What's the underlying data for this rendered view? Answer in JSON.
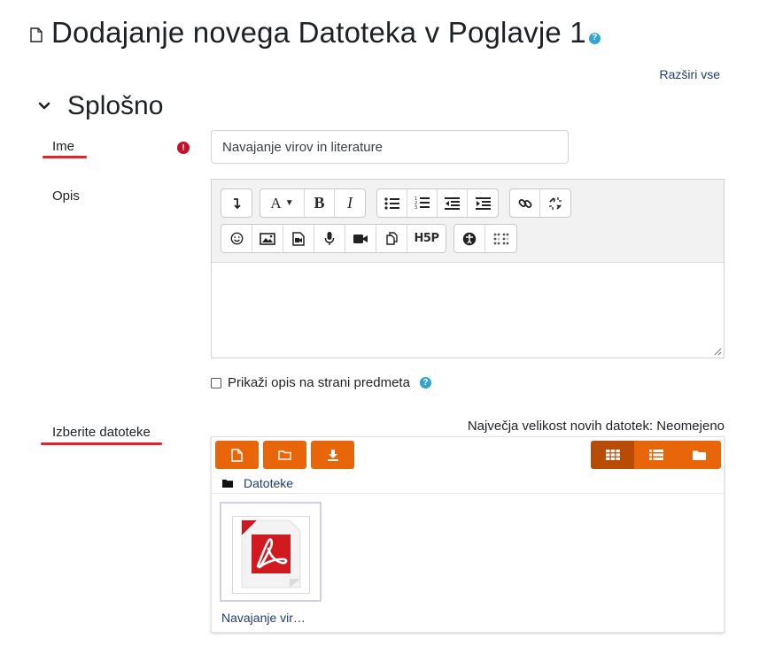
{
  "page": {
    "title": "Dodajanje novega Datoteka v Poglavje 1",
    "help_glyph": "?",
    "expand_all": "Razširi vse"
  },
  "section": {
    "title": "Splošno"
  },
  "fields": {
    "name": {
      "label": "Ime",
      "required_glyph": "!",
      "value": "Navajanje virov in literature"
    },
    "description": {
      "label": "Opis",
      "toolbar_row1": [
        "insert-more-icon",
        "font-size-icon",
        "bold-icon",
        "italic-icon",
        "bullet-list-icon",
        "numbered-list-icon",
        "outdent-icon",
        "indent-icon",
        "link-icon",
        "unlink-icon"
      ],
      "toolbar_row2": [
        "emoji-icon",
        "image-icon",
        "media-icon",
        "microphone-icon",
        "video-icon",
        "manage-files-icon",
        "h5p-icon",
        "accessibility-checker-icon",
        "screenreader-helper-icon"
      ],
      "bold_label": "B",
      "italic_label": "I",
      "font_label": "A",
      "h5p_label": "H5P"
    },
    "show_description": {
      "label": "Prikaži opis na strani predmeta",
      "checked": false
    },
    "files": {
      "label": "Izberite datoteke",
      "max_size_text": "Največja velikost novih datotek: Neomejeno",
      "path_label": "Datoteke",
      "files": [
        {
          "name": "Navajanje vir…",
          "type": "pdf"
        }
      ],
      "accent_color": "#e8650a",
      "active_view": "icons"
    }
  },
  "colors": {
    "link": "#1f3c78",
    "annotation_underline": "#e8202a",
    "required": "#c4102a",
    "help": "#2fa4d7"
  }
}
